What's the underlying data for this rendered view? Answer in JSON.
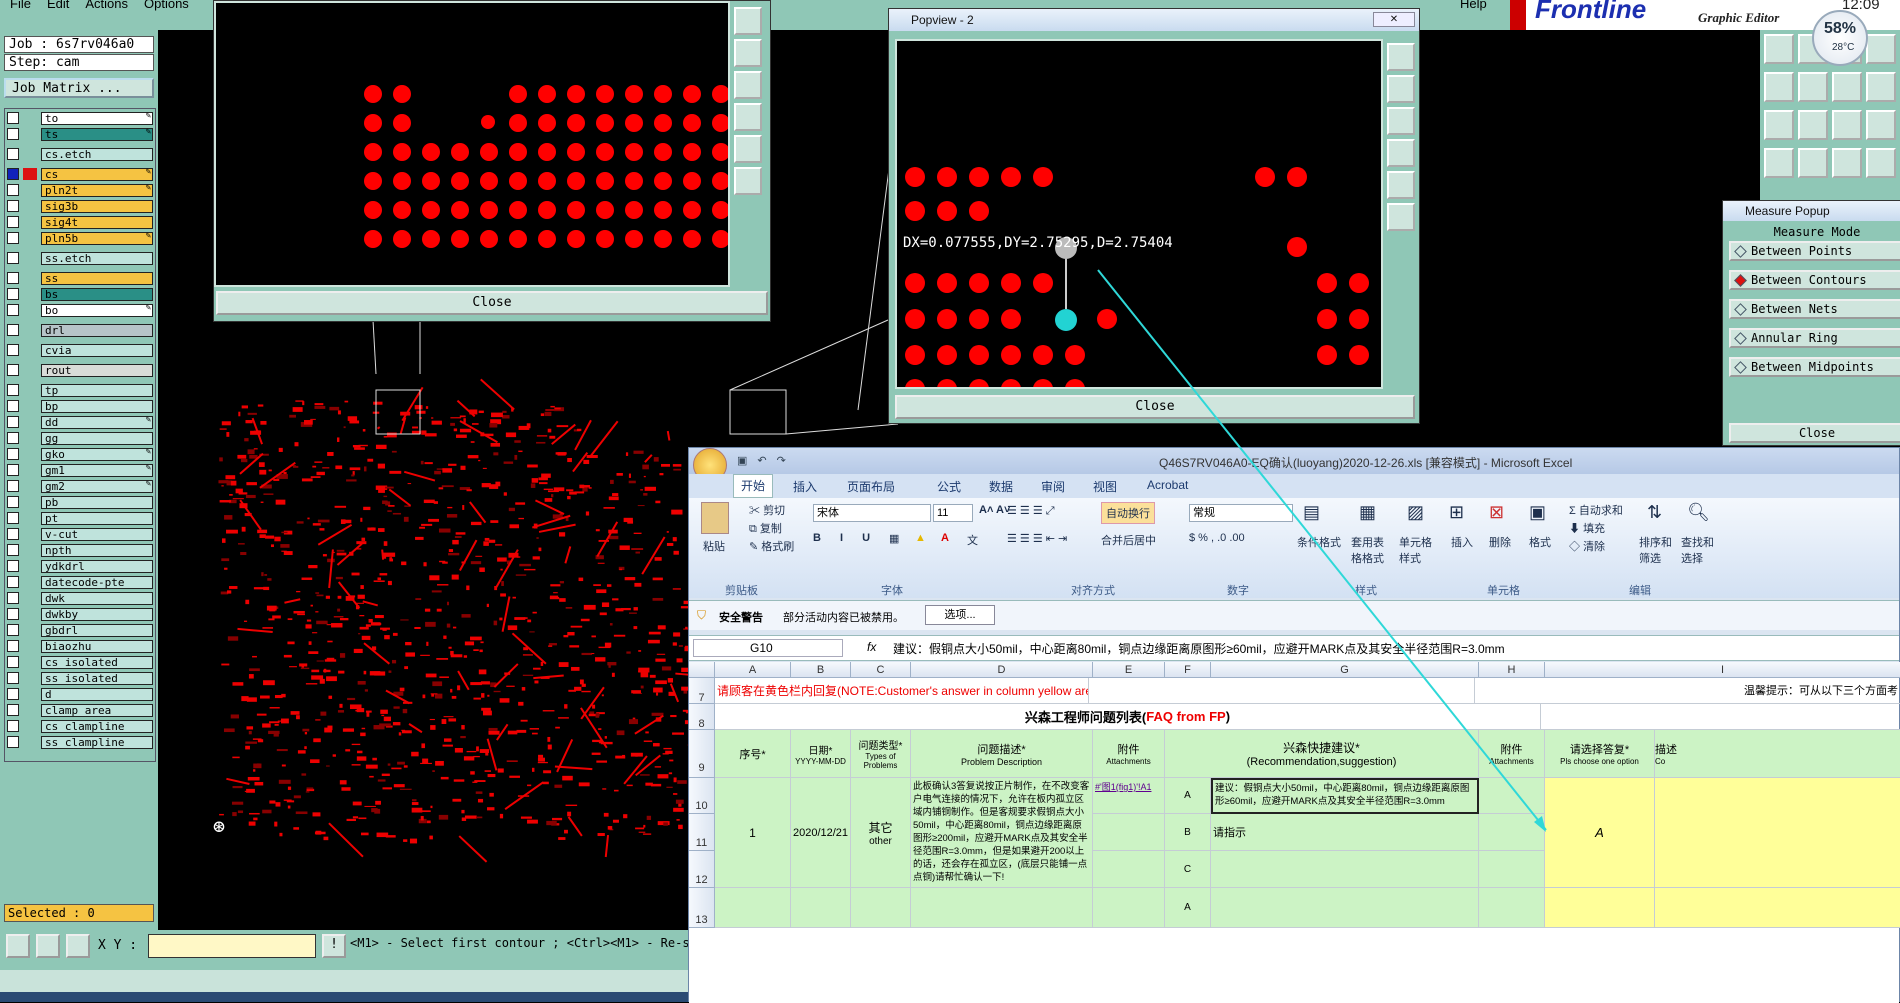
{
  "menubar": {
    "items": [
      "File",
      "Edit",
      "Actions",
      "Options"
    ],
    "help": "Help"
  },
  "brand": {
    "name": "Frontline",
    "subtitle": "Graphic Editor",
    "clock": "12:09"
  },
  "job": {
    "job_label": "Job : 6s7rv046a0",
    "step_label": "Step: cam",
    "matrix_button": "Job Matrix ..."
  },
  "layers": [
    {
      "name": "to",
      "color": "#ffffff",
      "edit": true
    },
    {
      "name": "ts",
      "color": "#2a8f86",
      "edit": true
    },
    {
      "name": "cs.etch",
      "color": "#bfe3dc",
      "edit": false
    },
    {
      "name": "cs",
      "color": "#f5c342",
      "edit": true,
      "active": true
    },
    {
      "name": "pln2t",
      "color": "#f5c342",
      "edit": true
    },
    {
      "name": "sig3b",
      "color": "#f5c342",
      "edit": false
    },
    {
      "name": "sig4t",
      "color": "#f5c342",
      "edit": false
    },
    {
      "name": "pln5b",
      "color": "#f5c342",
      "edit": true
    },
    {
      "name": "ss.etch",
      "color": "#bfe3dc",
      "edit": false
    },
    {
      "name": "ss",
      "color": "#f5c342",
      "edit": false
    },
    {
      "name": "bs",
      "color": "#2a8f86",
      "edit": false
    },
    {
      "name": "bo",
      "color": "#ffffff",
      "edit": true
    },
    {
      "name": "drl",
      "color": "#b7c4c8",
      "edit": false
    },
    {
      "name": "cvia",
      "color": "#bfe3dc",
      "edit": false
    },
    {
      "name": "rout",
      "color": "#d9dcd8",
      "edit": false
    },
    {
      "name": "tp",
      "color": "#bfe3dc",
      "edit": false
    },
    {
      "name": "bp",
      "color": "#bfe3dc",
      "edit": false
    },
    {
      "name": "dd",
      "color": "#bfe3dc",
      "edit": true
    },
    {
      "name": "gg",
      "color": "#bfe3dc",
      "edit": false
    },
    {
      "name": "gko",
      "color": "#bfe3dc",
      "edit": true
    },
    {
      "name": "gm1",
      "color": "#bfe3dc",
      "edit": true
    },
    {
      "name": "gm2",
      "color": "#bfe3dc",
      "edit": true
    },
    {
      "name": "pb",
      "color": "#bfe3dc",
      "edit": false
    },
    {
      "name": "pt",
      "color": "#bfe3dc",
      "edit": false
    },
    {
      "name": "v-cut",
      "color": "#bfe3dc",
      "edit": false
    },
    {
      "name": "npth",
      "color": "#bfe3dc",
      "edit": false
    },
    {
      "name": "ydkdrl",
      "color": "#bfe3dc",
      "edit": false
    },
    {
      "name": "datecode-pte",
      "color": "#bfe3dc",
      "edit": false
    },
    {
      "name": "dwk",
      "color": "#bfe3dc",
      "edit": false
    },
    {
      "name": "dwkby",
      "color": "#bfe3dc",
      "edit": false
    },
    {
      "name": "gbdrl",
      "color": "#bfe3dc",
      "edit": false
    },
    {
      "name": "biaozhu",
      "color": "#bfe3dc",
      "edit": false
    },
    {
      "name": "cs_isolated",
      "color": "#bfe3dc",
      "edit": false
    },
    {
      "name": "ss_isolated",
      "color": "#bfe3dc",
      "edit": false
    },
    {
      "name": "d",
      "color": "#bfe3dc",
      "edit": false
    },
    {
      "name": "clamp_area",
      "color": "#bfe3dc",
      "edit": false
    },
    {
      "name": "cs_clampline",
      "color": "#bfe3dc",
      "edit": false
    },
    {
      "name": "ss_clampline",
      "color": "#bfe3dc",
      "edit": false
    }
  ],
  "selected": "Selected : 0",
  "statusbar": {
    "xy_label": "X Y :",
    "prompt": "<M1> - Select first contour ; <Ctrl><M1> - Re-s"
  },
  "popview1": {
    "close": "Close"
  },
  "popview2": {
    "title": "Popview - 2",
    "measure": "DX=0.077555,DY=2.75295,D=2.75404",
    "close": "Close"
  },
  "measure_popup": {
    "title": "Measure Popup",
    "heading": "Measure Mode",
    "modes": [
      {
        "label": "Between Points",
        "selected": false
      },
      {
        "label": "Between Contours",
        "selected": true
      },
      {
        "label": "Between Nets",
        "selected": false
      },
      {
        "label": "Annular Ring",
        "selected": false
      },
      {
        "label": "Between Midpoints",
        "selected": false
      }
    ],
    "close": "Close"
  },
  "weather": {
    "percent": "58%",
    "temp": "28°C"
  },
  "excel": {
    "title": "Q46S7RV046A0-EQ确认(luoyang)2020-12-26.xls [兼容模式] - Microsoft Excel",
    "tabs": [
      "开始",
      "插入",
      "页面布局",
      "公式",
      "数据",
      "审阅",
      "视图",
      "Acrobat"
    ],
    "ribbon": {
      "paste": "粘贴",
      "cut": "剪切",
      "copy": "复制",
      "format_painter": "格式刷",
      "clipboard": "剪贴板",
      "font_name": "宋体",
      "font_size": "11",
      "font_group": "字体",
      "wrap": "自动换行",
      "merge": "合并后居中",
      "align_group": "对齐方式",
      "number_format": "常规",
      "number_group": "数字",
      "cond_format": "条件格式",
      "table_format": "套用表格格式",
      "cell_style": "单元格样式",
      "styles_group": "样式",
      "insert": "插入",
      "delete": "删除",
      "format": "格式",
      "cells_group": "单元格",
      "autosum": "自动求和",
      "fill": "填充",
      "clear": "清除",
      "sort_filter": "排序和筛选",
      "find_select": "查找和选择",
      "edit_group": "编辑"
    },
    "security": {
      "label": "安全警告",
      "message": "部分活动内容已被禁用。",
      "button": "选项..."
    },
    "formula": {
      "cell_ref": "G10",
      "fx": "fx",
      "content": "建议：假铜点大小50mil，中心距离80mil，铜点边缘距离原图形≥60mil，应避开MARK点及其安全半径范围R=3.0mm"
    },
    "columns": [
      "A",
      "B",
      "C",
      "D",
      "E",
      "F",
      "G",
      "H",
      "I"
    ],
    "rows": [
      "7",
      "8",
      "9",
      "10",
      "11",
      "12",
      "13"
    ],
    "row7_note": "请顾客在黄色栏内回复(NOTE:Customer's answer in column yellow area)",
    "row7_tip": "温馨提示：可从以下三个方面考",
    "sheet_title_cn": "兴森工程师问题列表(",
    "sheet_title_en": "FAQ from FP",
    "sheet_title_end": ")",
    "headers": {
      "seq": "序号*",
      "date": "日期*",
      "date_fmt": "YYYY-MM-DD",
      "type": "问题类型*",
      "type_en": "Types of Problems",
      "desc": "问题描述*",
      "desc_en": "Problem Description",
      "attach": "附件",
      "attach_en": "Attachments",
      "rec": "兴森快捷建议*",
      "rec_en": "(Recommendation,suggestion)",
      "attach2": "附件",
      "attach2_en": "Attachments",
      "choose": "请选择答复*",
      "choose_en": "Pls choose one option",
      "desc2": "描述",
      "desc2_en": "Co"
    },
    "row1": {
      "seq": "1",
      "date": "2020/12/21",
      "type": "其它",
      "type_en": "other",
      "desc": "此板确认3答复说按正片制作，在不改变客户电气连接的情况下，允许在板内孤立区域内铺铜制作。但是客规要求假铜点大小50mil，中心距离80mil，铜点边缘距离原图形≥200mil，应避开MARK点及其安全半径范围R=3.0mm，但是如果避开200以上的话，还会存在孤立区，(底层只能铺一点点铜)请帮忙确认一下!",
      "attach": "#'图1(fig1)'!A1",
      "options": [
        {
          "key": "A",
          "text": "建议：假铜点大小50mil，中心距离80mil，铜点边缘距离原图形≥60mil，应避开MARK点及其安全半径范围R=3.0mm"
        },
        {
          "key": "B",
          "text": "请指示"
        },
        {
          "key": "C",
          "text": ""
        }
      ],
      "answer": "A"
    },
    "row13_key": "A"
  }
}
